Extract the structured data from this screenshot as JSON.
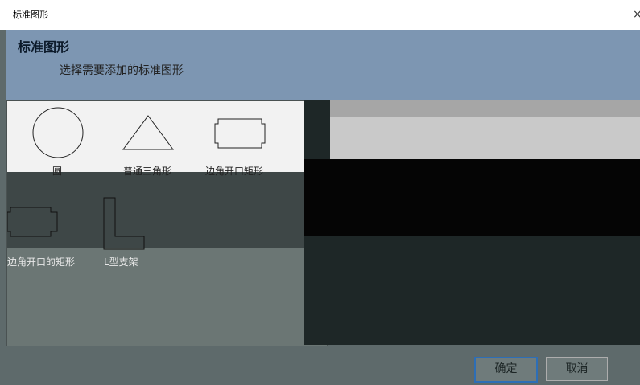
{
  "window": {
    "title": "标准图形",
    "close_glyph": "×"
  },
  "banner": {
    "title": "标准图形",
    "subtitle": "选择需要添加的标准图形"
  },
  "shapes": [
    {
      "label": "圆",
      "icon": "circle-icon"
    },
    {
      "label": "普通三角形",
      "icon": "triangle-icon"
    },
    {
      "label": "边角开口矩形",
      "icon": "notched-rectangle-icon"
    },
    {
      "label": "边角开口的矩形",
      "icon": "notched-rectangle-icon"
    },
    {
      "label": "L型支架",
      "icon": "l-bracket-icon"
    }
  ],
  "buttons": {
    "ok": "确定",
    "cancel": "取消"
  },
  "colors": {
    "banner": "#7d96b2",
    "primary_border": "#2d6eb6"
  }
}
